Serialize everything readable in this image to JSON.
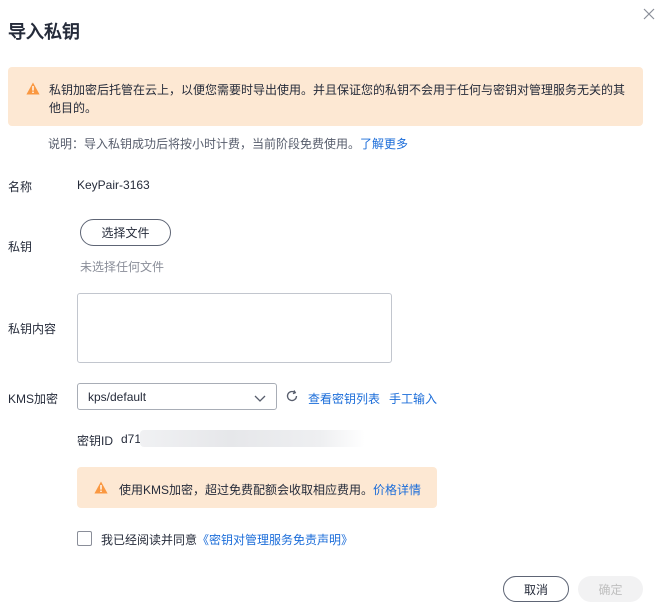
{
  "dialog": {
    "title": "导入私钥"
  },
  "warning": {
    "text": "私钥加密后托管在云上，以便您需要时导出使用。并且保证您的私钥不会用于任何与密钥对管理服务无关的其他目的。"
  },
  "note": {
    "text": "说明：导入私钥成功后将按小时计费，当前阶段免费使用。",
    "link": "了解更多"
  },
  "form": {
    "name_label": "名称",
    "name_value": "KeyPair-3163",
    "private_key_label": "私钥",
    "choose_file_button": "选择文件",
    "no_file_text": "未选择任何文件",
    "content_label": "私钥内容",
    "content_value": "",
    "kms_label": "KMS加密",
    "kms_selected": "kps/default",
    "view_keys_link": "查看密钥列表",
    "manual_input_link": "手工输入",
    "key_id_label": "密钥ID",
    "key_id_value": "d71"
  },
  "fee_notice": {
    "text": "使用KMS加密，超过免费配额会收取相应费用。",
    "link": "价格详情"
  },
  "agreement": {
    "text": "我已经阅读并同意",
    "link": "《密钥对管理服务免责声明》",
    "checked": false
  },
  "footer": {
    "cancel_label": "取消",
    "confirm_label": "确定"
  },
  "colors": {
    "accent_link": "#1a6cd9",
    "warning_bg": "#fde8d3",
    "warning_icon": "#fa9841"
  },
  "icons": [
    "close-icon",
    "warning-icon",
    "chevron-down-icon",
    "refresh-icon"
  ]
}
